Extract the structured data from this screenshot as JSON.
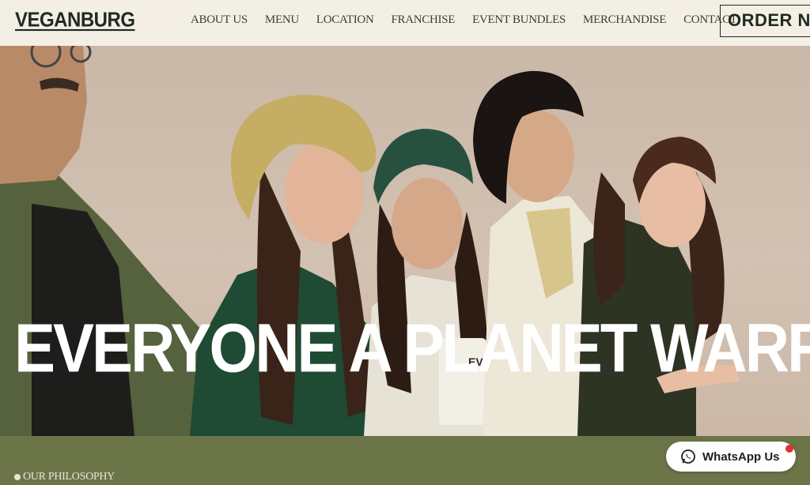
{
  "brand": {
    "logo": "VEGANBURG"
  },
  "nav": {
    "items": [
      {
        "label": "ABOUT US"
      },
      {
        "label": "MENU"
      },
      {
        "label": "LOCATION"
      },
      {
        "label": "FRANCHISE"
      },
      {
        "label": "EVENT BUNDLES"
      },
      {
        "label": "MERCHANDISE"
      },
      {
        "label": "CONTACT"
      }
    ],
    "order_label": "ORDER NOW"
  },
  "hero": {
    "headline": "EVERYONE A PLANET WARRIOR",
    "cup_text": "EVE"
  },
  "section": {
    "label": "OUR PHILOSOPHY"
  },
  "whatsapp": {
    "label": "WhatsApp Us"
  },
  "colors": {
    "nav_bg": "#f4efe4",
    "accent_green": "#6b7548",
    "text_dark": "#1f2a22",
    "badge_red": "#e0302e"
  }
}
